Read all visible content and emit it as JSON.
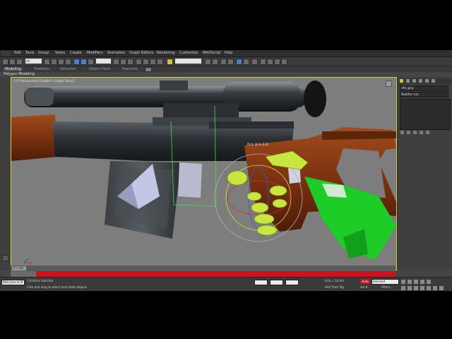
{
  "menubar": {
    "items": [
      "Edit",
      "Tools",
      "Group",
      "Views",
      "Create",
      "Modifiers",
      "Animation",
      "Graph Editors",
      "Rendering",
      "Customize",
      "MAXScript",
      "Help"
    ]
  },
  "toolbar": {
    "selection_filter": "All"
  },
  "ribbon": {
    "tabs": [
      "Modeling",
      "Freeform",
      "Selection",
      "Object Paint",
      "Populate"
    ],
    "active_tab": "Modeling",
    "panel_label": "Polygon Modeling"
  },
  "viewport": {
    "label": "[+] [Perspective] [Shaded + Edged Faces]",
    "transform_readout": "[0.0, 10.0, 0.0]"
  },
  "command_panel": {
    "object_name": "rifle_grip",
    "modifier_list_label": "Modifier List"
  },
  "timeline": {
    "frame_readout": "0 / 100"
  },
  "statusbar": {
    "selection_count": "1 Entities Selected",
    "prompt": "Click and drag to select and rotate objects",
    "script_label": "Welcome to M",
    "add_time_tag": "Add Time Tag",
    "grid_label": "Grid = 10.0m",
    "auto_key": "Auto",
    "selected_dropdown": "Selected",
    "set_key": "Set K.",
    "filters": "Filters..."
  },
  "colors": {
    "viewport_bg": "#7d7d7d",
    "selection_frame": "#d8c83a",
    "timeline_red": "#c8141e",
    "gizmo_yellow": "#c8e640",
    "helper_green": "#1ecc28"
  }
}
